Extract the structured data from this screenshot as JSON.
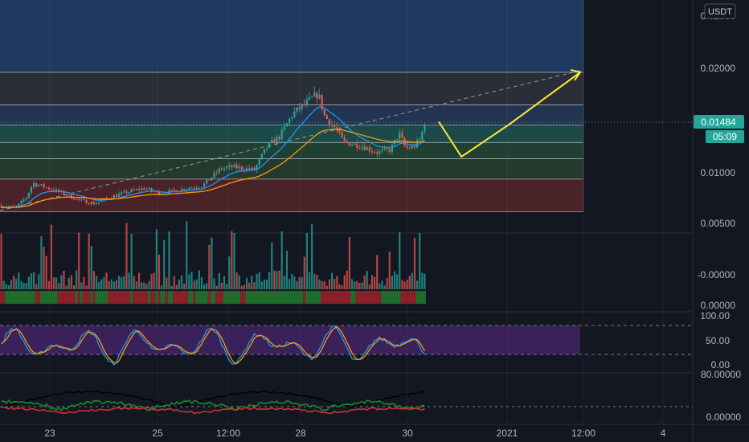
{
  "currency": "USDT",
  "price_axis": {
    "labels": [
      "0.02000",
      "0.01500",
      "0.01000",
      "0.00500"
    ],
    "top_partial_label": "0.02500",
    "current_price": "0.01484",
    "countdown": "05:09"
  },
  "volume_axis": {
    "labels": [
      "-0.00000",
      "0.00000"
    ]
  },
  "stoch_axis": {
    "labels": [
      "100.00",
      "50.00",
      "0.00"
    ]
  },
  "dmi_axis": {
    "labels": [
      "80.00000",
      "0.00000"
    ]
  },
  "time_axis": {
    "labels": [
      "23",
      "25",
      "12:00",
      "28",
      "30",
      "2021",
      "12:00",
      "4"
    ]
  },
  "colors": {
    "background": "#131722",
    "candle_up": "#26a69a",
    "candle_down": "#ef5350",
    "ma_fast": "#2196f3",
    "ma_slow": "#ff9800",
    "projection": "#ffeb3b",
    "price_badge": "#26a69a",
    "stoch_band": "#5b2a86"
  },
  "chart_data": {
    "type": "candlestick",
    "symbol_quote": "USDT",
    "y_ticks": [
      0.005,
      0.01,
      0.015,
      0.02,
      0.025
    ],
    "ylim": [
      0.0039,
      0.0268
    ],
    "last_price": 0.01484,
    "fib_levels": [
      0.0197,
      0.0165,
      0.0145,
      0.0128,
      0.0112,
      0.0092,
      0.006
    ],
    "zones": [
      {
        "from": 0.0197,
        "to": 0.0268,
        "color": "#1e3a5f"
      },
      {
        "from": 0.0165,
        "to": 0.0197,
        "color": "#2a2e39"
      },
      {
        "from": 0.0145,
        "to": 0.0165,
        "color": "#22344f"
      },
      {
        "from": 0.0128,
        "to": 0.0145,
        "color": "#1b4a48"
      },
      {
        "from": 0.0112,
        "to": 0.0128,
        "color": "#1f4033"
      },
      {
        "from": 0.0092,
        "to": 0.0112,
        "color": "#253a2e"
      },
      {
        "from": 0.006,
        "to": 0.0092,
        "color": "#4a2329"
      }
    ],
    "price_path": [
      {
        "t": 0.0,
        "p": 0.0066
      },
      {
        "t": 0.04,
        "p": 0.0064
      },
      {
        "t": 0.065,
        "p": 0.0074
      },
      {
        "t": 0.08,
        "p": 0.0088
      },
      {
        "t": 0.11,
        "p": 0.0084
      },
      {
        "t": 0.15,
        "p": 0.0078
      },
      {
        "t": 0.19,
        "p": 0.0071
      },
      {
        "t": 0.225,
        "p": 0.0068
      },
      {
        "t": 0.26,
        "p": 0.0074
      },
      {
        "t": 0.3,
        "p": 0.0079
      },
      {
        "t": 0.34,
        "p": 0.0083
      },
      {
        "t": 0.38,
        "p": 0.0078
      },
      {
        "t": 0.43,
        "p": 0.0082
      },
      {
        "t": 0.48,
        "p": 0.0086
      },
      {
        "t": 0.52,
        "p": 0.0102
      },
      {
        "t": 0.55,
        "p": 0.0104
      },
      {
        "t": 0.6,
        "p": 0.0101
      },
      {
        "t": 0.63,
        "p": 0.0124
      },
      {
        "t": 0.66,
        "p": 0.0134
      },
      {
        "t": 0.69,
        "p": 0.0156
      },
      {
        "t": 0.72,
        "p": 0.0166
      },
      {
        "t": 0.75,
        "p": 0.0176
      },
      {
        "t": 0.765,
        "p": 0.0154
      },
      {
        "t": 0.79,
        "p": 0.0142
      },
      {
        "t": 0.81,
        "p": 0.0128
      },
      {
        "t": 0.85,
        "p": 0.0125
      },
      {
        "t": 0.89,
        "p": 0.0118
      },
      {
        "t": 0.92,
        "p": 0.0121
      },
      {
        "t": 0.94,
        "p": 0.0137
      },
      {
        "t": 0.955,
        "p": 0.0122
      },
      {
        "t": 0.975,
        "p": 0.0124
      },
      {
        "t": 0.99,
        "p": 0.0131
      },
      {
        "t": 1.0,
        "p": 0.01484
      }
    ],
    "projection": [
      {
        "t": 0.0,
        "p": 0.01484
      },
      {
        "t": 0.16,
        "p": 0.0114
      },
      {
        "t": 0.49,
        "p": 0.0145
      },
      {
        "t": 1.0,
        "p": 0.0197
      }
    ],
    "stoch_levels": [
      80,
      20
    ],
    "stoch_range": [
      0,
      100
    ],
    "dmi_ylim": [
      0,
      80
    ]
  }
}
